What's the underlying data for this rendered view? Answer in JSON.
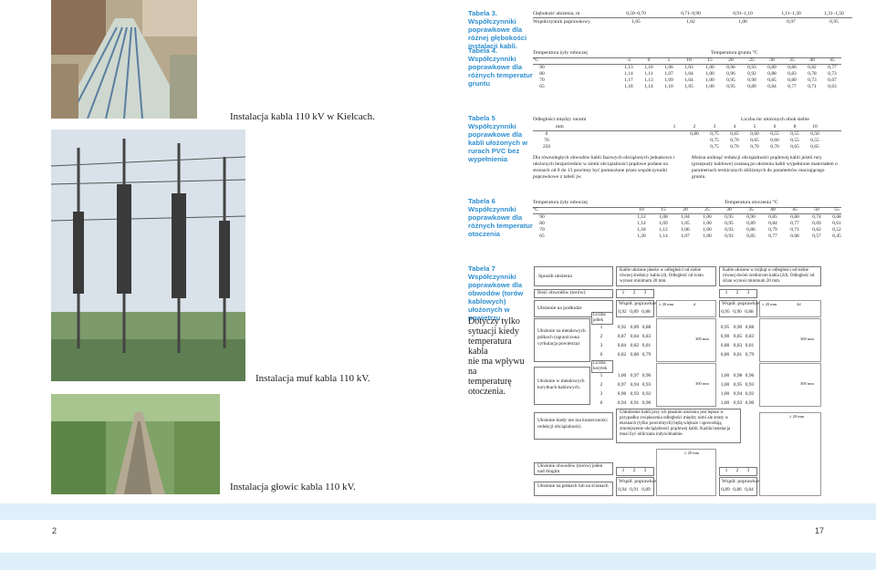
{
  "page_numbers": {
    "left": "2",
    "right": "17"
  },
  "captions": {
    "photo1": "Instalacja kabla 110 kV w Kielcach.",
    "photo2": "Instalacja muf kabla 110 kV.",
    "photo3": "Instalacja głowic kabla 110 kV."
  },
  "table3": {
    "side": [
      "Tabela 3.",
      "Współczynniki",
      "poprawkowe dla",
      "różnej głębokości",
      "instalacji kabli."
    ],
    "rows": [
      {
        "label": "Głębokość ułożenia, m",
        "values": [
          "0,50–0,70",
          "0,71–0,90",
          "0,91–1,10",
          "1,11–1,30",
          "1,31–1,50"
        ]
      },
      {
        "label": "Współczynnik poprawkowy",
        "values": [
          "1,05",
          "1,02",
          "1,00",
          "0,97",
          "0,95"
        ]
      }
    ]
  },
  "table4": {
    "side": [
      "Tabela 4.",
      "Współczynniki",
      "poprawkowe dla",
      "różnych temperatur",
      "gruntu"
    ],
    "head1": "Temperatura żyły roboczej",
    "head2": "Temperatura gruntu °C",
    "unit": "°C",
    "cols": [
      "-5",
      "0",
      "5",
      "10",
      "15",
      "20",
      "25",
      "30",
      "35",
      "40",
      "45"
    ],
    "rows": [
      {
        "t": "90",
        "v": [
          "1,13",
          "1,10",
          "1,06",
          "1,03",
          "1,00",
          "0,96",
          "0,93",
          "0,89",
          "0,86",
          "0,82",
          "0,77"
        ]
      },
      {
        "t": "80",
        "v": [
          "1,14",
          "1,11",
          "1,07",
          "1,04",
          "1,00",
          "0,96",
          "0,92",
          "0,88",
          "0,83",
          "0,78",
          "0,73"
        ]
      },
      {
        "t": "70",
        "v": [
          "1,17",
          "1,13",
          "1,09",
          "1,04",
          "1,00",
          "0,95",
          "0,90",
          "0,85",
          "0,80",
          "0,73",
          "0,67"
        ]
      },
      {
        "t": "65",
        "v": [
          "1,18",
          "1,14",
          "1,10",
          "1,05",
          "1,00",
          "0,95",
          "0,89",
          "0,84",
          "0,77",
          "0,71",
          "0,63"
        ]
      }
    ]
  },
  "table5": {
    "side": [
      "Tabela 5",
      "Współczynniki",
      "poprawkowe dla",
      "kabli ułożonych w",
      "rurach PVC bez",
      "wypełnienia"
    ],
    "head1": "Odległości między rurami",
    "head2": "Liczba rur ułożonych obok siebie",
    "unit": "mm",
    "cols": [
      "1",
      "2",
      "3",
      "4",
      "5",
      "6",
      "8",
      "10"
    ],
    "rows": [
      {
        "t": "0",
        "v": [
          "",
          "0,80",
          "0,75",
          "0,65",
          "0,60",
          "0,55",
          "0,55",
          "0,50"
        ]
      },
      {
        "t": "70",
        "v": [
          "",
          "",
          "0,75",
          "0,70",
          "0,65",
          "0,60",
          "0,55",
          "0,55"
        ]
      },
      {
        "t": "250",
        "v": [
          "",
          "",
          "0,75",
          "0,70",
          "0,70",
          "0,70",
          "0,65",
          "0,65"
        ]
      }
    ],
    "note_left": "Dla równoległych obwodów kabli fazowych obciążonych jednakowo i ułożonych bezpośrednio w ziemi obciążalności prądowe podane na stronach od 8 do 13 powinny być pomnożone przez współczynniki poprawkowe z tabeli jw.",
    "note_right": "Można uniknąć redukcji obciążalności prądowej kabli jeżeli rury (przepusty kablowe) zostaną po ułożeniu kabli wypełnione materiałem o parametrach termicznych zbliżonych do parametrów otaczającego gruntu."
  },
  "table6": {
    "side": [
      "Tabela 6",
      "Współczynniki",
      "poprawkowe dla",
      "różnych temperatur",
      "otoczenia"
    ],
    "head1": "Temperatura żyły roboczej",
    "head2": "Temperatura otoczenia °C",
    "unit": "°C",
    "cols": [
      "10",
      "15",
      "20",
      "25",
      "30",
      "35",
      "40",
      "45",
      "50",
      "55"
    ],
    "rows": [
      {
        "t": "90",
        "v": [
          "1,12",
          "1,08",
          "1,04",
          "1,00",
          "0,95",
          "0,90",
          "0,85",
          "0,80",
          "0,74",
          "0,68"
        ]
      },
      {
        "t": "80",
        "v": [
          "1,14",
          "1,09",
          "1,05",
          "1,00",
          "0,95",
          "0,89",
          "0,84",
          "0,77",
          "0,69",
          "0,61"
        ]
      },
      {
        "t": "70",
        "v": [
          "1,18",
          "1,12",
          "1,06",
          "1,00",
          "0,93",
          "0,86",
          "0,79",
          "0,71",
          "0,62",
          "0,52"
        ]
      },
      {
        "t": "65",
        "v": [
          "1,20",
          "1,14",
          "1,07",
          "1,00",
          "0,93",
          "0,85",
          "0,77",
          "0,68",
          "0,57",
          "0,45"
        ]
      }
    ]
  },
  "table7": {
    "side": [
      "Tabela 7",
      "Współczynniki",
      "poprawkowe dla",
      "obwodów (torów",
      "kablowych)",
      "ułożonych w",
      "powietrzu"
    ],
    "side_note": [
      "Dotyczy tylko",
      "sytuacji kiedy",
      "temperatura kabla",
      "nie ma wpływu na",
      "temperaturę",
      "otoczenia."
    ],
    "sposob": "Sposób ułożenia",
    "head_a": "Kable ułożone płasko w odległości od siebie równej średnicy kabla (d). Odległość od ścian wynosi minimum 20 mm.",
    "head_b": "Kable ułożone w trójkąt w odległości od siebie równej dwóm średnicom kabla (2d). Odległość od ścian wynosi minimum 20 mm.",
    "ilosc": "Ilość obwodów (torów)",
    "ilosc_vals": [
      "1",
      "2",
      "3"
    ],
    "wspol": "Współ. poprawkowy",
    "podloga": "Ułożenie na podłodze",
    "podloga_a": [
      "0,92",
      "0,89",
      "0,88"
    ],
    "podloga_b": [
      "0,95",
      "0,90",
      "0,88"
    ],
    "liczba_polek": "Liczba półek",
    "liczba_korytek": "Liczba korytek",
    "polki_label": "Ułożenie na metalowych półkach (ograniczona cyrkulacja powietrza)",
    "polki_rows": [
      {
        "n": "1",
        "a": [
          "0,92",
          "0,89",
          "0,88"
        ],
        "b": [
          "0,95",
          "0,90",
          "0,88"
        ]
      },
      {
        "n": "2",
        "a": [
          "0,87",
          "0,84",
          "0,83"
        ],
        "b": [
          "0,90",
          "0,85",
          "0,83"
        ]
      },
      {
        "n": "3",
        "a": [
          "0,84",
          "0,82",
          "0,81"
        ],
        "b": [
          "0,88",
          "0,83",
          "0,81"
        ]
      },
      {
        "n": "6",
        "a": [
          "0,82",
          "0,80",
          "0,79"
        ],
        "b": [
          "0,86",
          "0,81",
          "0,79"
        ]
      }
    ],
    "korytka_label": "Ułożenie w metalowych korytkach kablowych.",
    "korytka_rows": [
      {
        "n": "1",
        "a": [
          "1,00",
          "0,97",
          "0,96"
        ],
        "b": [
          "1,00",
          "0,98",
          "0,96"
        ]
      },
      {
        "n": "2",
        "a": [
          "0,97",
          "0,94",
          "0,93"
        ],
        "b": [
          "1,00",
          "0,95",
          "0,93"
        ]
      },
      {
        "n": "3",
        "a": [
          "0,96",
          "0,93",
          "0,92"
        ],
        "b": [
          "1,00",
          "0,94",
          "0,92"
        ]
      },
      {
        "n": "6",
        "a": [
          "0,94",
          "0,91",
          "0,90"
        ],
        "b": [
          "1,00",
          "0,93",
          "0,90"
        ]
      }
    ],
    "brak_label": "Ułożenie kiedy nie ma konieczności redukcji obciążalności.",
    "brak_text": "Chłodzenie kabli przy ich płaskim ułożeniu jest lepsze w przypadku zwiększenia odległości między nimi ale straty w ekranach (tylko powrotnych) będą większe i spowodują zmniejszenie obciążalności prądowej kabli. Każda instalacja musi być obliczana indywidualnie.",
    "odstep_label": "Ułożenie obwodów (torów) jeden nad drugim",
    "odstep_vals": [
      "1",
      "2",
      "3"
    ],
    "scianie_label": "Ułożenie na półkach lub na ścianach",
    "scianie_vals": [
      "0,94",
      "0,91",
      "0,89"
    ],
    "scianie_vals_b": [
      "0,89",
      "0,86",
      "0,84"
    ],
    "dim_20mm": "≥ 20 mm",
    "dim_d": "d",
    "dim_2d": "2d",
    "dim_300": "300 mm"
  },
  "colors": {
    "accent": "#2f8fd0",
    "strip": "#dff0fa"
  }
}
